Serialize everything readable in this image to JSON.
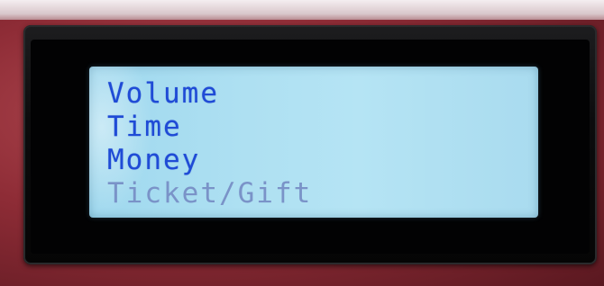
{
  "display": {
    "menu_items": [
      {
        "label": "Volume",
        "state": "active"
      },
      {
        "label": "Time",
        "state": "active"
      },
      {
        "label": "Money",
        "state": "active"
      },
      {
        "label": "Ticket/Gift",
        "state": "dim"
      }
    ]
  },
  "colors": {
    "lcd_background": "#aee0f2",
    "text_active": "#1f4bd6",
    "text_dim": "#7a93c8",
    "bezel": "#0c0c0d",
    "casing": "#8e2c36"
  }
}
